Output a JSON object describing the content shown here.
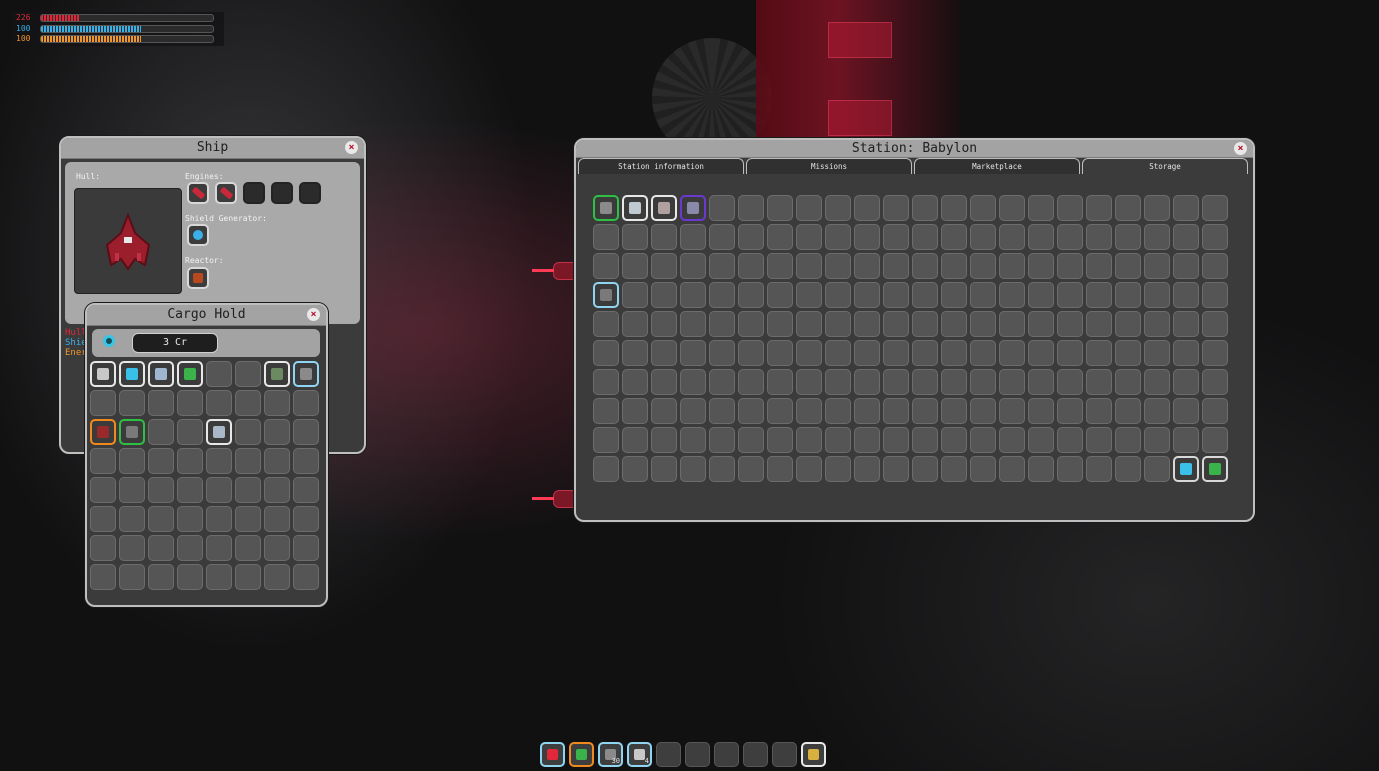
{
  "hud": {
    "hull": {
      "value": "226",
      "fill": 0.22,
      "color": "#e0283a"
    },
    "shield": {
      "value": "100",
      "fill": 0.58,
      "color": "#3ab0e6"
    },
    "energy": {
      "value": "100",
      "fill": 0.58,
      "color": "#f0962a"
    }
  },
  "ship_panel": {
    "title": "Ship",
    "close": "×",
    "hull_label": "Hull:",
    "engines_label": "Engines:",
    "shield_gen_label": "Shield Generator:",
    "reactor_label": "Reactor:",
    "stats": [
      "Hull",
      "Shie",
      "Ener"
    ],
    "stat_colors": [
      "#e0283a",
      "#3ab0e6",
      "#f0962a"
    ],
    "engine_slots": [
      {
        "icon": "red-engine-icon",
        "color": "#c8283a",
        "border": "#d8d8d8"
      },
      {
        "icon": "red-engine-icon",
        "color": "#c8283a",
        "border": "#d8d8d8"
      },
      null,
      null,
      null
    ],
    "shield_slot": {
      "icon": "shield-generator-icon",
      "color": "#3ab0e6",
      "border": "#d8d8d8"
    },
    "reactor_slot": {
      "icon": "reactor-icon",
      "color": "#b8481e",
      "border": "#d8d8d8"
    }
  },
  "cargo": {
    "title": "Cargo Hold",
    "close": "×",
    "credits": "3 Cr",
    "cols": 8,
    "rows": 8,
    "items": [
      {
        "index": 0,
        "icon": "ship-icon",
        "color": "#c8c8c8",
        "border": "#e8e8e8"
      },
      {
        "index": 1,
        "icon": "cyan-laser-icon",
        "color": "#3ac0e8",
        "border": "#e8e8e8"
      },
      {
        "index": 2,
        "icon": "ship-icon",
        "color": "#9fb6d0",
        "border": "#e8e8e8"
      },
      {
        "index": 3,
        "icon": "green-laser-icon",
        "color": "#39b34a",
        "border": "#e8e8e8"
      },
      {
        "index": 6,
        "icon": "armor-icon",
        "color": "#6c8a62",
        "border": "#e8e8e8"
      },
      {
        "index": 7,
        "icon": "scrap-icon",
        "color": "#8a8a8a",
        "border": "#8fd4f0"
      },
      {
        "index": 16,
        "icon": "red-ship-icon",
        "color": "#9a2a2a",
        "border": "#f08a1e"
      },
      {
        "index": 17,
        "icon": "engine-part-icon",
        "color": "#7a7a7a",
        "border": "#2ec044"
      },
      {
        "index": 20,
        "icon": "ship-icon",
        "color": "#a8b8c8",
        "border": "#e8e8e8"
      }
    ]
  },
  "station": {
    "title": "Station: Babylon",
    "close": "×",
    "tabs": [
      "Station information",
      "Missions",
      "Marketplace",
      "Storage"
    ],
    "active_tab": 3,
    "cols": 22,
    "rows": 10,
    "items": [
      {
        "index": 0,
        "icon": "turret-icon",
        "color": "#8a8a8a",
        "border": "#2ec044"
      },
      {
        "index": 1,
        "icon": "mech-icon",
        "color": "#c0c8d0",
        "border": "#e8e8e8"
      },
      {
        "index": 2,
        "icon": "ship-icon",
        "color": "#b0a0a0",
        "border": "#e8e8e8"
      },
      {
        "index": 3,
        "icon": "ship-icon",
        "color": "#8a8aa8",
        "border": "#6a3ad0"
      },
      {
        "index": 66,
        "icon": "plate-icon",
        "color": "#7a7a7a",
        "border": "#8fd4f0"
      },
      {
        "index": 218,
        "icon": "cyan-laser-icon",
        "color": "#3ac0e8",
        "border": "#d8d8d8"
      },
      {
        "index": 219,
        "icon": "green-laser-icon",
        "color": "#39b34a",
        "border": "#d8d8d8"
      }
    ]
  },
  "hotbar": [
    {
      "icon": "red-laser-icon",
      "color": "#e0283a",
      "border": "#8fd4f0",
      "count": ""
    },
    {
      "icon": "green-laser-icon",
      "color": "#39b34a",
      "border": "#f08a1e",
      "count": ""
    },
    {
      "icon": "plate-icon",
      "color": "#8a8a8a",
      "border": "#8fd4f0",
      "count": "30"
    },
    {
      "icon": "ship-icon",
      "color": "#c8c8c8",
      "border": "#8fd4f0",
      "count": "4"
    },
    null,
    null,
    null,
    null,
    null,
    {
      "icon": "reactor-icon",
      "color": "#d8b040",
      "border": "#e8e8e8",
      "count": ""
    }
  ]
}
